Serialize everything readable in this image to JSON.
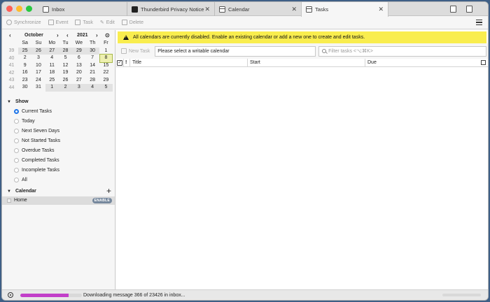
{
  "tabs": [
    {
      "label": "Inbox",
      "icon": "mail-icon"
    },
    {
      "label": "Thunderbird Privacy Notice",
      "icon": "thunderbird-icon",
      "close": "✕"
    },
    {
      "label": "Calendar",
      "icon": "calendar-icon",
      "close": "✕"
    },
    {
      "label": "Tasks",
      "icon": "tasks-icon",
      "close": "✕"
    }
  ],
  "toolbar": {
    "synchronize": "Synchronize",
    "event": "Event",
    "task": "Task",
    "edit": "Edit",
    "delete": "Delete"
  },
  "minicalendar": {
    "month": "October",
    "year": "2021",
    "prev": "‹",
    "next": "›",
    "day_names": [
      "Sa",
      "Su",
      "Mo",
      "Tu",
      "We",
      "Th",
      "Fr"
    ],
    "weeks": [
      {
        "wk": "39",
        "days": [
          "25",
          "26",
          "27",
          "28",
          "29",
          "30",
          "1"
        ]
      },
      {
        "wk": "40",
        "days": [
          "2",
          "3",
          "4",
          "5",
          "6",
          "7",
          "8"
        ]
      },
      {
        "wk": "41",
        "days": [
          "9",
          "10",
          "11",
          "12",
          "13",
          "14",
          "15"
        ]
      },
      {
        "wk": "42",
        "days": [
          "16",
          "17",
          "18",
          "19",
          "20",
          "21",
          "22"
        ]
      },
      {
        "wk": "43",
        "days": [
          "23",
          "24",
          "25",
          "26",
          "27",
          "28",
          "29"
        ]
      },
      {
        "wk": "44",
        "days": [
          "30",
          "31",
          "1",
          "2",
          "3",
          "4",
          "5"
        ]
      }
    ],
    "today": "8"
  },
  "show": {
    "title": "Show",
    "options": [
      "Current Tasks",
      "Today",
      "Next Seven Days",
      "Not Started Tasks",
      "Overdue Tasks",
      "Completed Tasks",
      "Incomplete Tasks",
      "All"
    ],
    "selected": "Current Tasks"
  },
  "calendar_section": {
    "title": "Calendar",
    "items": [
      {
        "name": "Home",
        "badge": "ENABLE"
      }
    ]
  },
  "notice": "All calendars are currently disabled. Enable an existing calendar or add a new one to create and edit tasks.",
  "taskbar": {
    "new_task": "New Task",
    "quick_add_value": "Please select a writable calendar",
    "filter_placeholder": "Filter tasks <⌥⌘K>"
  },
  "columns": [
    "Title",
    "Start",
    "Due"
  ],
  "status": {
    "message": "Downloading message 366 of 23426 in inbox...",
    "progress": 0.78
  },
  "colors": {
    "notice_bg": "#f9ed4e",
    "progress_fill": "#c23fc9",
    "today_highlight": "#eef0b0",
    "radio_selected": "#1a73e8"
  }
}
